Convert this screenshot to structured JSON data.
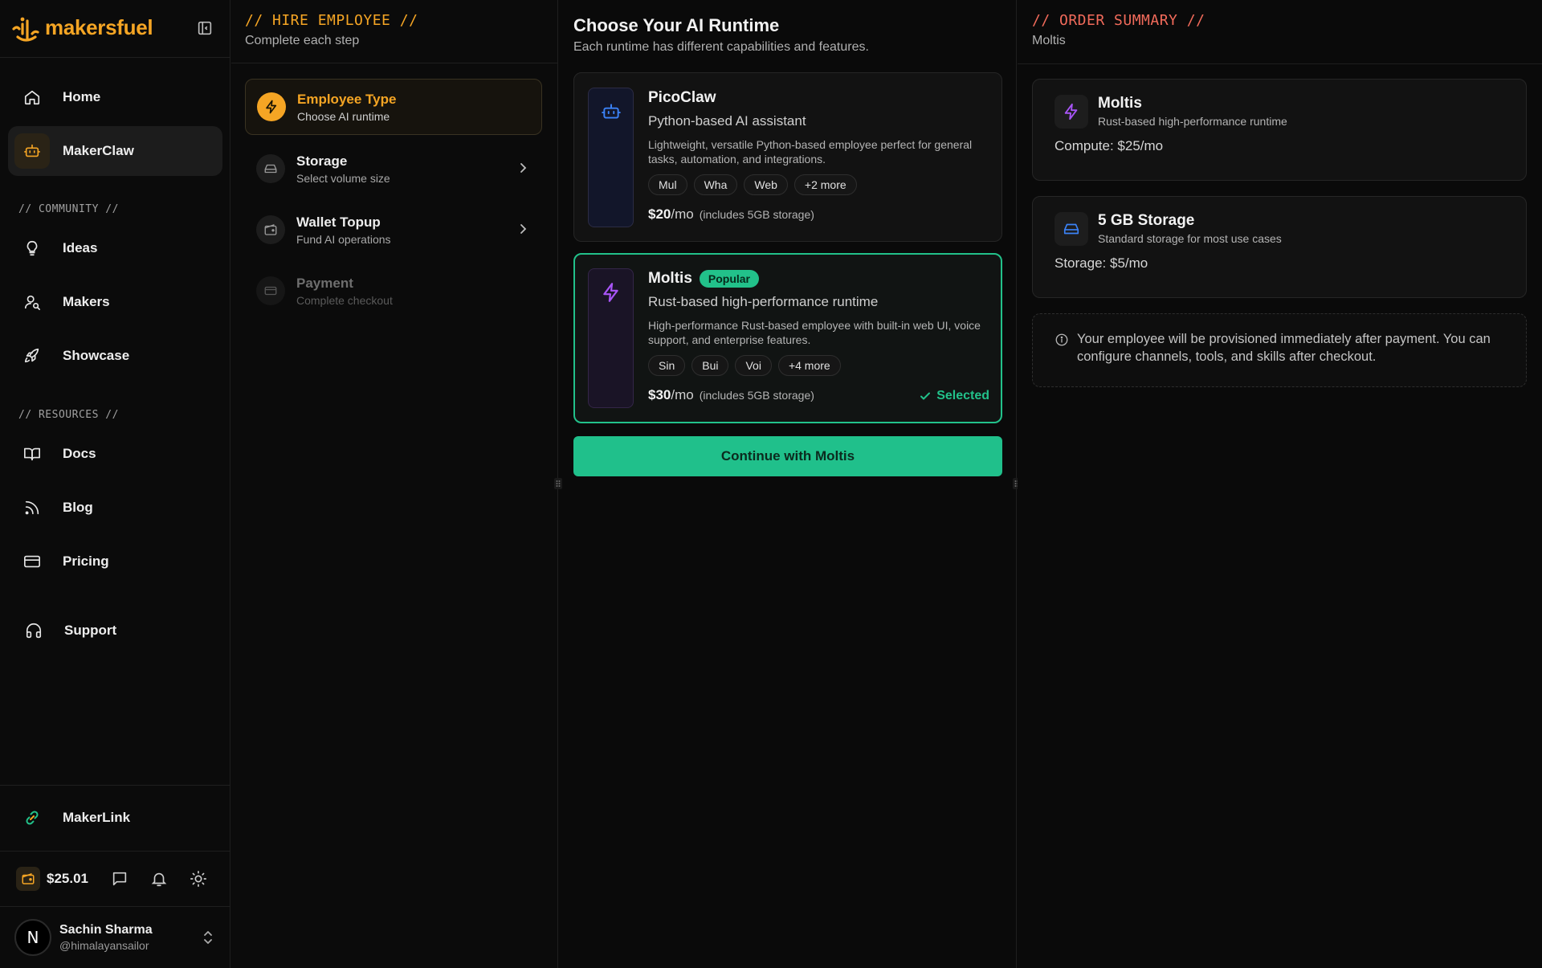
{
  "brand": {
    "name": "makersfuel",
    "accent": "#f5a524"
  },
  "sidebar": {
    "primary": [
      {
        "label": "Home",
        "icon": "home-icon"
      },
      {
        "label": "MakerClaw",
        "icon": "robot-icon",
        "active": true
      }
    ],
    "community_label": "// COMMUNITY //",
    "community": [
      {
        "label": "Ideas",
        "icon": "lightbulb-icon"
      },
      {
        "label": "Makers",
        "icon": "user-search-icon"
      },
      {
        "label": "Showcase",
        "icon": "rocket-icon"
      }
    ],
    "resources_label": "// RESOURCES //",
    "resources": [
      {
        "label": "Docs",
        "icon": "book-icon"
      },
      {
        "label": "Blog",
        "icon": "rss-icon"
      },
      {
        "label": "Pricing",
        "icon": "credit-card-icon"
      }
    ],
    "support": {
      "label": "Support",
      "icon": "headphones-icon"
    },
    "makerlink": {
      "label": "MakerLink",
      "icon": "link-icon"
    },
    "wallet": {
      "amount": "$25.01"
    },
    "user": {
      "initial": "N",
      "name": "Sachin Sharma",
      "handle": "@himalayansailor"
    }
  },
  "steps_panel": {
    "title": "// HIRE EMPLOYEE //",
    "subtitle": "Complete each step",
    "steps": [
      {
        "title": "Employee Type",
        "desc": "Choose AI runtime",
        "state": "active",
        "icon": "bolt-icon"
      },
      {
        "title": "Storage",
        "desc": "Select volume size",
        "state": "pending",
        "icon": "hard-drive-icon"
      },
      {
        "title": "Wallet Topup",
        "desc": "Fund AI operations",
        "state": "pending",
        "icon": "wallet-icon"
      },
      {
        "title": "Payment",
        "desc": "Complete checkout",
        "state": "disabled",
        "icon": "card-icon"
      }
    ]
  },
  "runtime": {
    "title": "Choose Your AI Runtime",
    "subtitle": "Each runtime has different capabilities and features.",
    "options": [
      {
        "name": "PicoClaw",
        "tagline": "Python-based AI assistant",
        "desc": "Lightweight, versatile Python-based employee perfect for general tasks, automation, and integrations.",
        "chips": [
          "Mul",
          "Wha",
          "Web",
          "+2 more"
        ],
        "price": "$20",
        "unit": "/mo",
        "note": "(includes 5GB storage)",
        "icon": "robot-icon",
        "icon_color": "#3b82f6"
      },
      {
        "name": "Moltis",
        "badge": "Popular",
        "tagline": "Rust-based high-performance runtime",
        "desc": "High-performance Rust-based employee with built-in web UI, voice support, and enterprise features.",
        "chips": [
          "Sin",
          "Bui",
          "Voi",
          "+4 more"
        ],
        "price": "$30",
        "unit": "/mo",
        "note": "(includes 5GB storage)",
        "selected_label": "Selected",
        "icon": "bolt-icon",
        "icon_color": "#a855f7"
      }
    ],
    "continue_label": "Continue with Moltis"
  },
  "summary": {
    "title": "// ORDER SUMMARY //",
    "subtitle": "Moltis",
    "items": [
      {
        "name": "Moltis",
        "desc": "Rust-based high-performance runtime",
        "line": "Compute: $25/mo",
        "icon": "bolt-icon",
        "icon_color": "#a855f7"
      },
      {
        "name": "5 GB Storage",
        "desc": "Standard storage for most use cases",
        "line": "Storage: $5/mo",
        "icon": "hard-drive-icon",
        "icon_color": "#3b82f6"
      }
    ],
    "info": "Your employee will be provisioned immediately after payment. You can configure channels, tools, and skills after checkout."
  },
  "colors": {
    "success": "#22c18a",
    "accent": "#f5a524",
    "order_title": "#f26b5b"
  }
}
